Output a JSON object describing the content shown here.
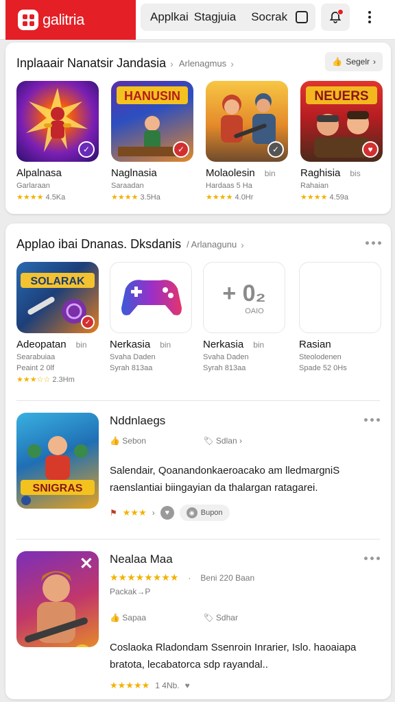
{
  "header": {
    "brand": "galitria",
    "nav": [
      "Applkai",
      "Stagjuia",
      "Socrak"
    ],
    "notification_dot_color": "#e41f26"
  },
  "section1": {
    "title": "Inplaaair Nanatsir Jandasia",
    "subtitle": "Arlenagmus",
    "see_all": "Segelr",
    "apps": [
      {
        "name": "Alpalnasa",
        "extra": "",
        "dev": "Garlaraan",
        "stars": "★★★★",
        "rating": "4.5Ka",
        "icon": "hero-burst-icon"
      },
      {
        "name": "Naglnasia",
        "extra": "",
        "dev": "Saraadan",
        "stars": "★★★★",
        "rating": "3.5Ha",
        "icon": "hanusin-game-icon"
      },
      {
        "name": "Molaolesin",
        "extra": "bin",
        "dev": "Hardaas 5 Ha",
        "stars": "★★★★",
        "rating": "4.0Hr",
        "icon": "soldiers-icon"
      },
      {
        "name": "Raghisia",
        "extra": "bis",
        "dev": "Rahaian",
        "stars": "★★★★",
        "rating": "4.59a",
        "icon": "neuers-icon"
      }
    ]
  },
  "section2": {
    "title": "Applao ibai Dnanas. Dksdanis",
    "subtitle": "Arlanagunu",
    "apps": [
      {
        "name": "Adeopatan",
        "extra": "bin",
        "dev": "Searabuiaa",
        "line3": "Peaint 2 0lf",
        "stars": "★★★☆☆",
        "rating": "2.3Hm",
        "icon": "sword-game-icon"
      },
      {
        "name": "Nerkasia",
        "extra": "bin",
        "dev": "Svaha Daden",
        "line3": "Syrah 813aa",
        "stars": "",
        "rating": "",
        "icon": "gamepad-icon"
      },
      {
        "name": "Rasian",
        "extra": "",
        "dev": "Steolodenen",
        "line3": "Spade 52 0Hs",
        "stars": "",
        "rating": "",
        "icon": "blank-icon"
      }
    ],
    "placeholder_glyph": "+ 0₂",
    "placeholder_sub": "OAIO",
    "featured": [
      {
        "title": "Nddnlaegs",
        "meta1": "Sebon",
        "meta2": "Sdlan",
        "desc": "Salendair, Qoanandonkaeroacako am lledmargniS raenslantiai biingayian da thalargan ratagarei.",
        "stars": "★★★",
        "chip": "Bupon",
        "icon_label": "SNIGRAS"
      },
      {
        "title": "Nealaa Maa",
        "stars": "★★★★★★★★",
        "meta_right": "Beni 220 Baan",
        "sub": "Packak→P",
        "meta1": "Sapaa",
        "meta2": "Sdhar",
        "desc": "Coslaoka Rladondam Ssenroin Inrarier, Islo. haoaiapa bratota, lecabatorca sdp rayandal..",
        "bottom_stars": "★★★★★",
        "bottom_rating": "1 4Nb."
      }
    ]
  }
}
